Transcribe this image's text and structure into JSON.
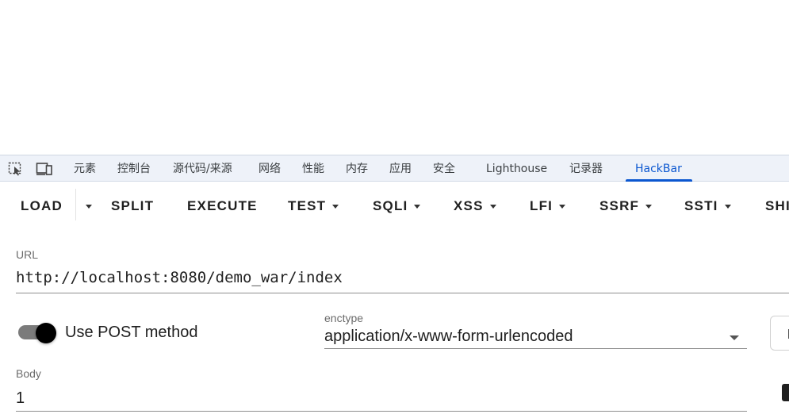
{
  "devtools": {
    "tabs": [
      {
        "label": "元素"
      },
      {
        "label": "控制台"
      },
      {
        "label": "源代码/来源"
      },
      {
        "label": "网络"
      },
      {
        "label": "性能"
      },
      {
        "label": "内存"
      },
      {
        "label": "应用"
      },
      {
        "label": "安全"
      },
      {
        "label": "Lighthouse"
      },
      {
        "label": "记录器"
      },
      {
        "label": "HackBar"
      }
    ],
    "active_tab": "HackBar",
    "icons": [
      "inspect-element-icon",
      "device-toolbar-icon"
    ]
  },
  "toolbar": {
    "load": "LOAD",
    "split": "SPLIT",
    "execute": "EXECUTE",
    "test": "TEST",
    "sqli": "SQLI",
    "xss": "XSS",
    "lfi": "LFI",
    "ssrf": "SSRF",
    "ssti": "SSTI",
    "shell_partial": "SHI"
  },
  "url": {
    "label": "URL",
    "value": "http://localhost:8080/demo_war/index"
  },
  "post": {
    "toggle_label": "Use POST method",
    "enabled": true
  },
  "enctype": {
    "label": "enctype",
    "value": "application/x-www-form-urlencoded"
  },
  "body": {
    "label": "Body",
    "value": "1"
  },
  "colors": {
    "accent": "#0b57d0",
    "devtools_bar": "#eef2f9",
    "toggle_thumb": "#000000",
    "toggle_track": "#7b7b7b"
  }
}
